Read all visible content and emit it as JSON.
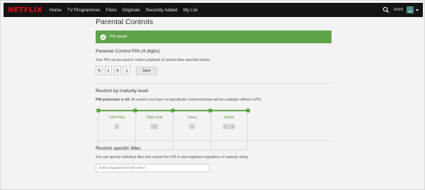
{
  "nav": {
    "logo": "NETFLIX",
    "items": [
      "Home",
      "TV Programmes",
      "Films",
      "Originals",
      "Recently Added",
      "My List"
    ],
    "kids_label": "KIDS"
  },
  "page": {
    "title": "Parental Controls"
  },
  "banner": {
    "text": "PIN saved!",
    "color": "#60a348"
  },
  "pin": {
    "title": "Parental Control PIN (4 digits)",
    "description": "Your PIN can be used to restrict playback of certain titles specified below.",
    "digits": [
      "5",
      "1",
      "5",
      "1"
    ],
    "save_label": "Save"
  },
  "maturity": {
    "title": "Restrict by maturity level",
    "status_bold": "PIN protection is off.",
    "status_rest": " All content you have not specifically restricted below will be available without a PIN.",
    "levels": [
      {
        "name": "Little Kids",
        "ratings": [
          "U"
        ]
      },
      {
        "name": "Older Kids",
        "ratings": [
          "PG"
        ]
      },
      {
        "name": "Teens",
        "ratings": [
          "12"
        ]
      },
      {
        "name": "Adults",
        "ratings": [
          "15",
          "18"
        ]
      }
    ],
    "accent_color": "#60a348"
  },
  "specific": {
    "title": "Restrict specific titles",
    "description": "You can specify individual titles that require the PIN to start playback regardless of maturity rating.",
    "placeholder": "Enter programme or film name"
  }
}
